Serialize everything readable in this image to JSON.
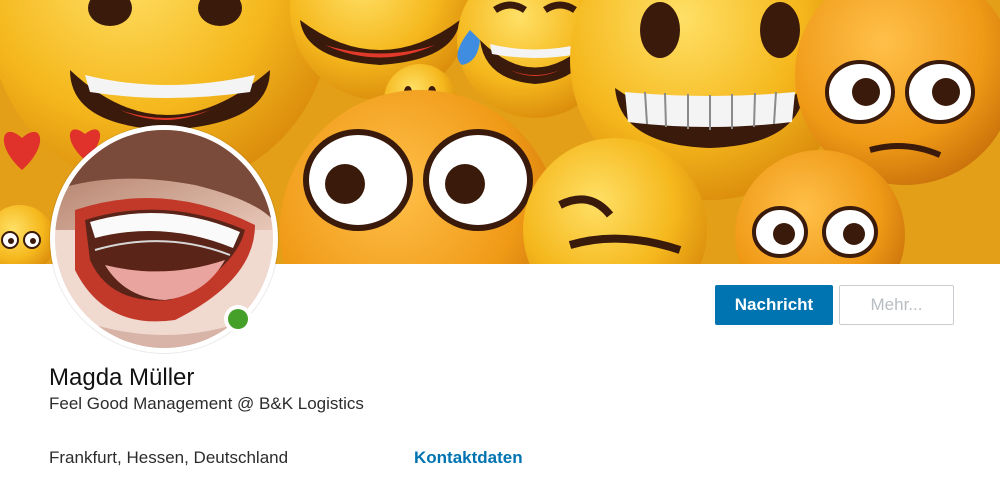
{
  "profile": {
    "name": "Magda Müller",
    "headline": "Feel Good Management @ B&K Logistics",
    "location": "Frankfurt, Hessen, Deutschland",
    "contact_label": "Kontaktdaten",
    "status": "online"
  },
  "actions": {
    "message_label": "Nachricht",
    "more_label": "Mehr..."
  },
  "colors": {
    "primary": "#0073b1",
    "presence": "#45a029",
    "text": "#2c2c2c",
    "muted_border": "#c8ccd0",
    "emoji_yellow": "#f5b81d"
  }
}
